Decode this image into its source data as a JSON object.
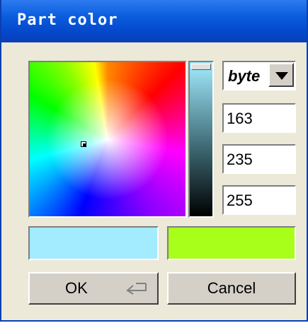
{
  "window": {
    "title": "Part color"
  },
  "format": {
    "selected": "byte"
  },
  "values": {
    "red": "163",
    "green": "235",
    "blue": "255"
  },
  "swatches": {
    "new_color": "#a3ebff",
    "old_color": "#a8ff1a"
  },
  "colors": {
    "titlebar": "#0a5cdd",
    "face": "#ece9d8",
    "button_face": "#d4d0c8"
  },
  "buttons": {
    "ok": "OK",
    "cancel": "Cancel"
  },
  "icons": {
    "combo_arrow": "dropdown-arrow-icon",
    "enter": "enter-key-icon"
  }
}
